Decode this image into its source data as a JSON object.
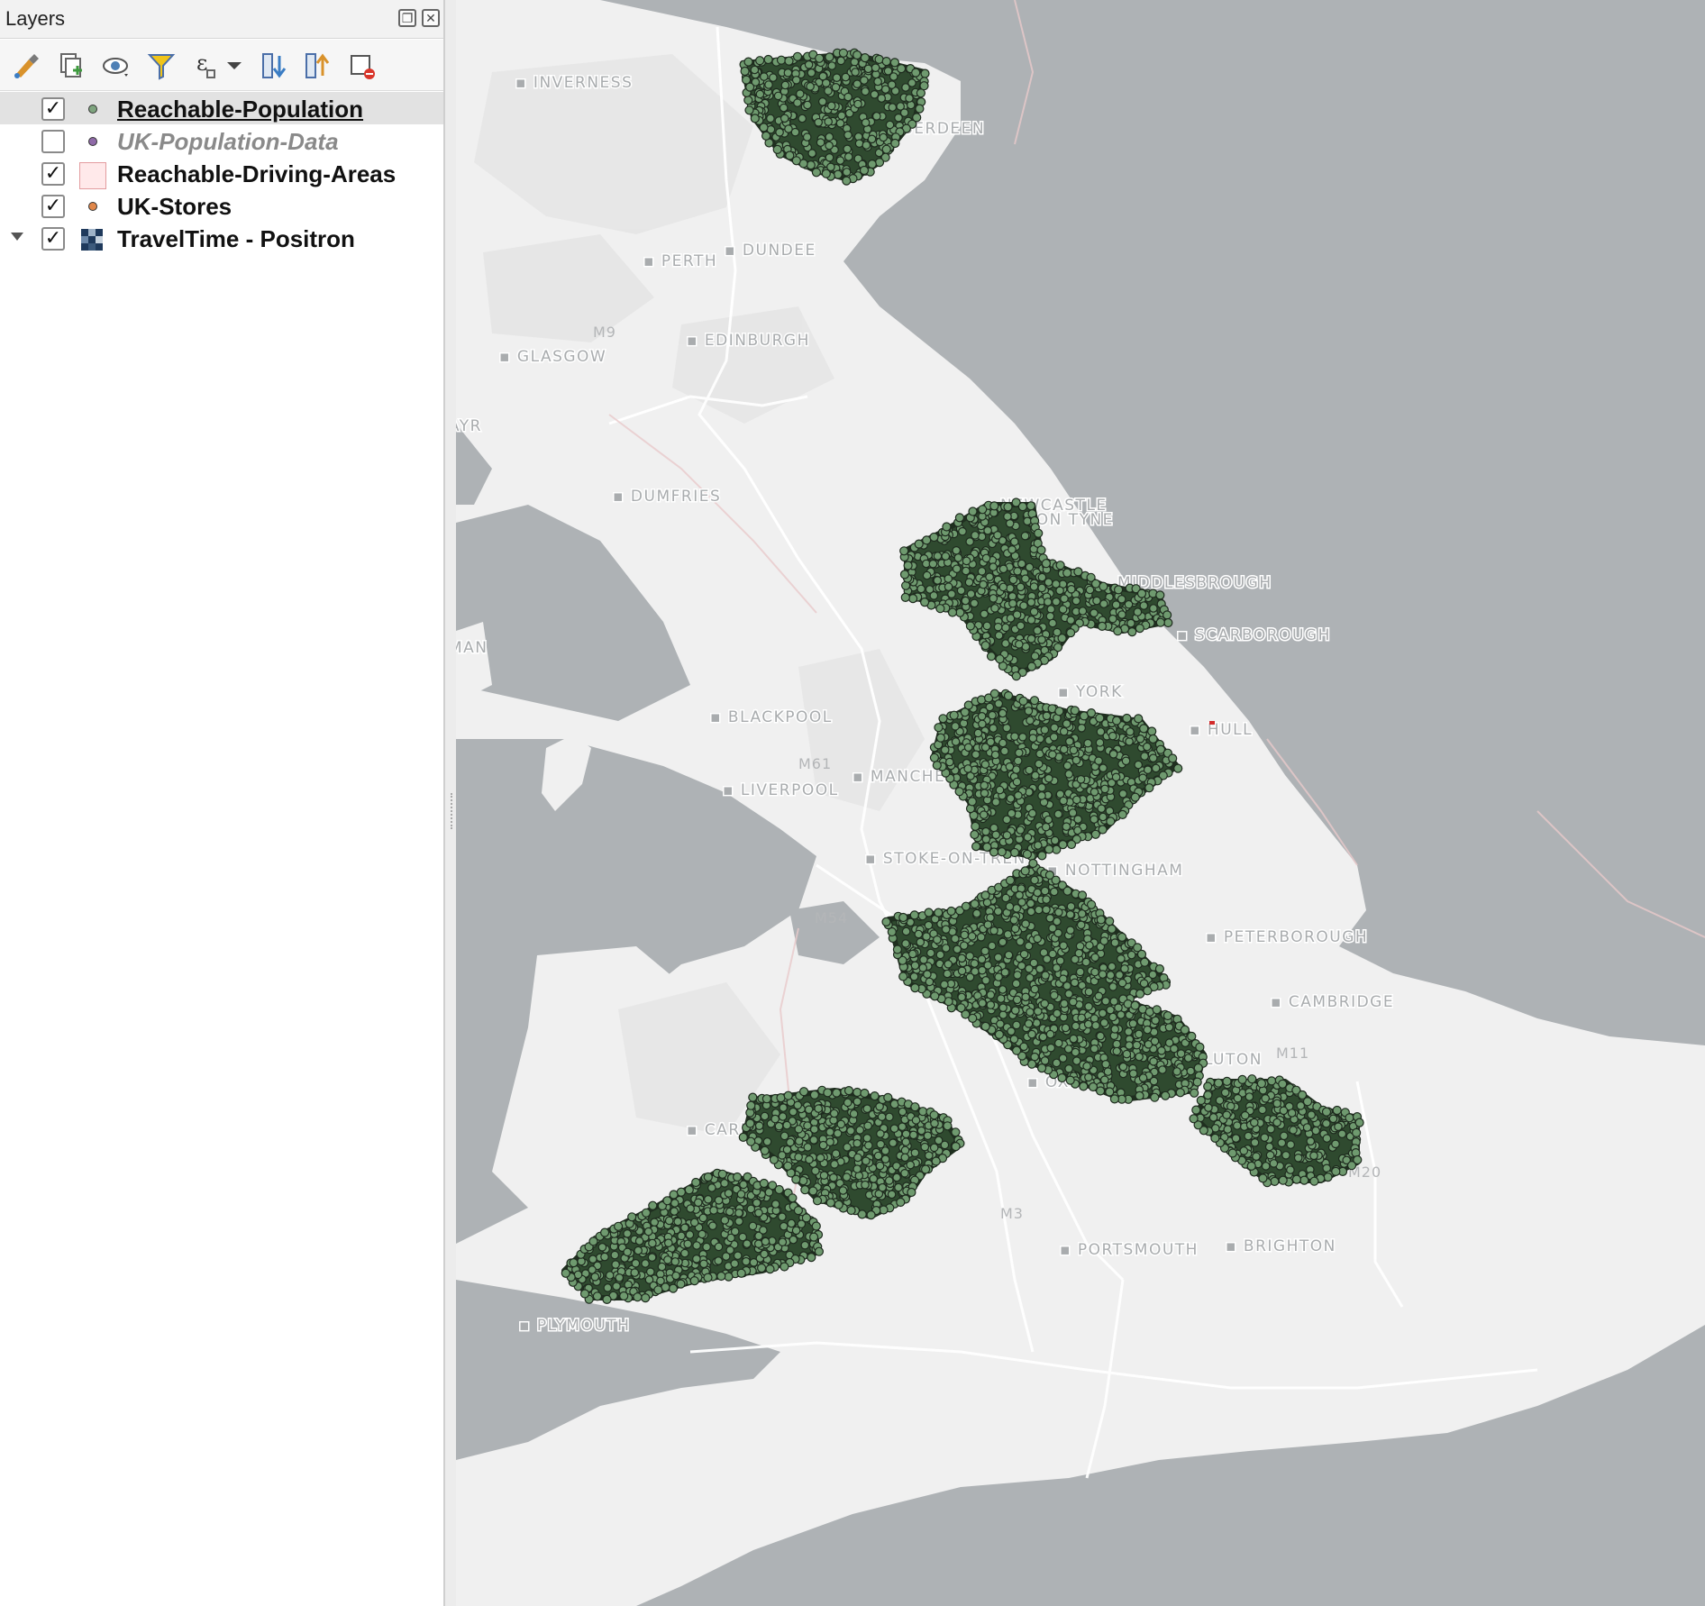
{
  "panel": {
    "title": "Layers",
    "float_icon": "float-window-icon",
    "close_icon": "close-icon"
  },
  "toolbar": [
    {
      "name": "open-layer-styling-icon"
    },
    {
      "name": "add-group-icon"
    },
    {
      "name": "manage-map-themes-icon"
    },
    {
      "name": "filter-legend-icon"
    },
    {
      "name": "filter-by-expression-icon"
    },
    {
      "name": "expand-all-icon"
    },
    {
      "name": "collapse-all-icon"
    },
    {
      "name": "remove-layer-icon"
    }
  ],
  "layers": [
    {
      "label": "Reachable-Population",
      "checked": true,
      "symbol": "point",
      "symbol_color": "#7ea47e",
      "selected": true
    },
    {
      "label": "UK-Population-Data",
      "checked": false,
      "symbol": "point",
      "symbol_color": "#8f6aa8",
      "selected": false
    },
    {
      "label": "Reachable-Driving-Areas",
      "checked": true,
      "symbol": "polygon",
      "symbol_color": "#ffe9ea",
      "selected": false
    },
    {
      "label": "UK-Stores",
      "checked": true,
      "symbol": "point",
      "symbol_color": "#e0874a",
      "selected": false
    },
    {
      "label": "TravelTime - Positron",
      "checked": true,
      "symbol": "raster",
      "symbol_color": "#1f3a5c",
      "selected": false
    }
  ],
  "map": {
    "sea_color": "#aeb2b5",
    "land_color": "#f0f0f0",
    "point_color": "#6f9a6f",
    "cities": [
      "INVERNESS",
      "ABERDEEN",
      "PERTH",
      "DUNDEE",
      "EDINBURGH",
      "GLASGOW",
      "AYR",
      "DUMFRIES",
      "NEWCASTLE",
      "UPON TYNE",
      "MIDDLESBROUGH",
      "SCARBOROUGH",
      "ISLE OF MAN",
      "YORK",
      "BLACKPOOL",
      "HULL",
      "MANCHESTER",
      "LIVERPOOL",
      "STOKE-ON-TRENT",
      "NOTTINGHAM",
      "PETERBOROUGH",
      "CAMBRIDGE",
      "LUTON",
      "OXFORD",
      "CARDIFF",
      "PORTSMOUTH",
      "BRIGHTON",
      "PLYMOUTH"
    ],
    "roads": [
      "M9",
      "M61",
      "M54",
      "M11",
      "M20",
      "M3"
    ]
  }
}
